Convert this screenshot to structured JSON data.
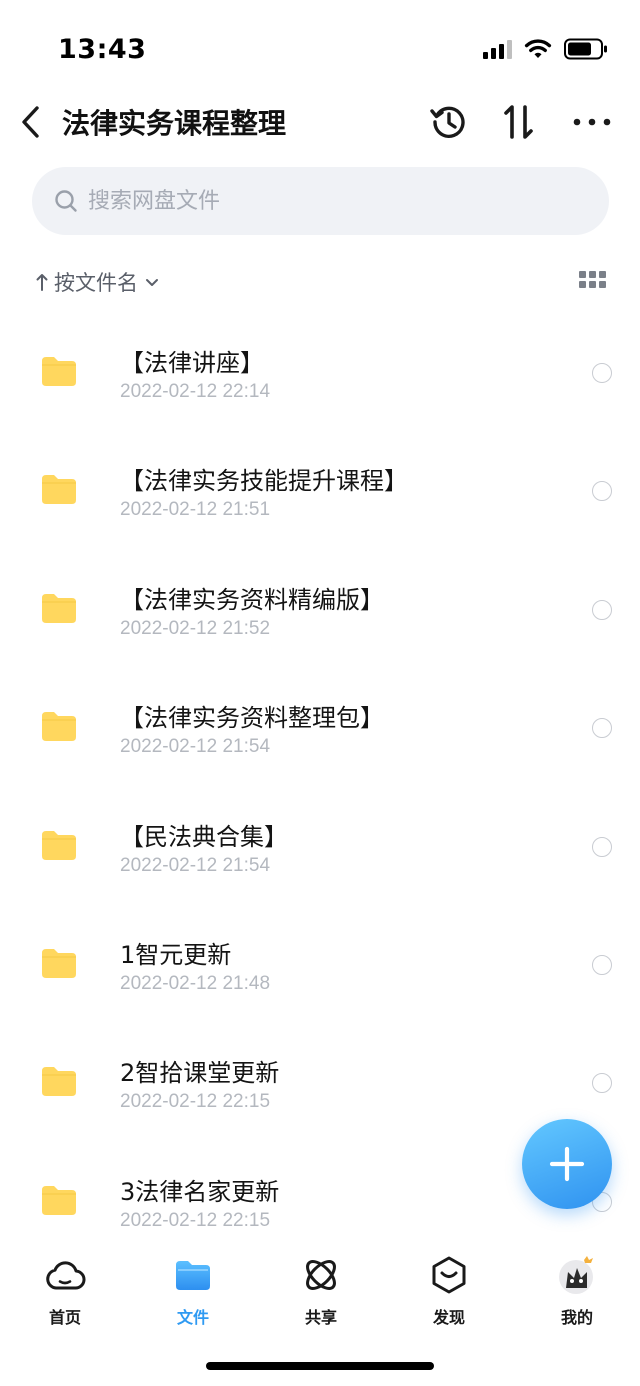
{
  "status_bar": {
    "time": "13:43"
  },
  "header": {
    "title": "法律实务课程整理"
  },
  "search": {
    "placeholder": "搜索网盘文件"
  },
  "sort": {
    "label": "按文件名"
  },
  "files": [
    {
      "name": "【法律讲座】",
      "date": "2022-02-12 22:14"
    },
    {
      "name": "【法律实务技能提升课程】",
      "date": "2022-02-12 21:51"
    },
    {
      "name": "【法律实务资料精编版】",
      "date": "2022-02-12 21:52"
    },
    {
      "name": "【法律实务资料整理包】",
      "date": "2022-02-12 21:54"
    },
    {
      "name": "【民法典合集】",
      "date": "2022-02-12 21:54"
    },
    {
      "name": "1智元更新",
      "date": "2022-02-12 21:48"
    },
    {
      "name": "2智拾课堂更新",
      "date": "2022-02-12 22:15"
    },
    {
      "name": "3法律名家更新",
      "date": "2022-02-12 22:15"
    }
  ],
  "nav": {
    "items": [
      {
        "label": "首页",
        "icon": "cloud-icon"
      },
      {
        "label": "文件",
        "icon": "folder-icon",
        "active": true
      },
      {
        "label": "共享",
        "icon": "share-orbit-icon"
      },
      {
        "label": "发现",
        "icon": "discover-icon"
      },
      {
        "label": "我的",
        "icon": "avatar"
      }
    ]
  },
  "colors": {
    "accent": "#2f9af2",
    "folder": "#ffd75e",
    "search_bg": "#f0f2f6",
    "date_gray": "#b4b8bf"
  }
}
